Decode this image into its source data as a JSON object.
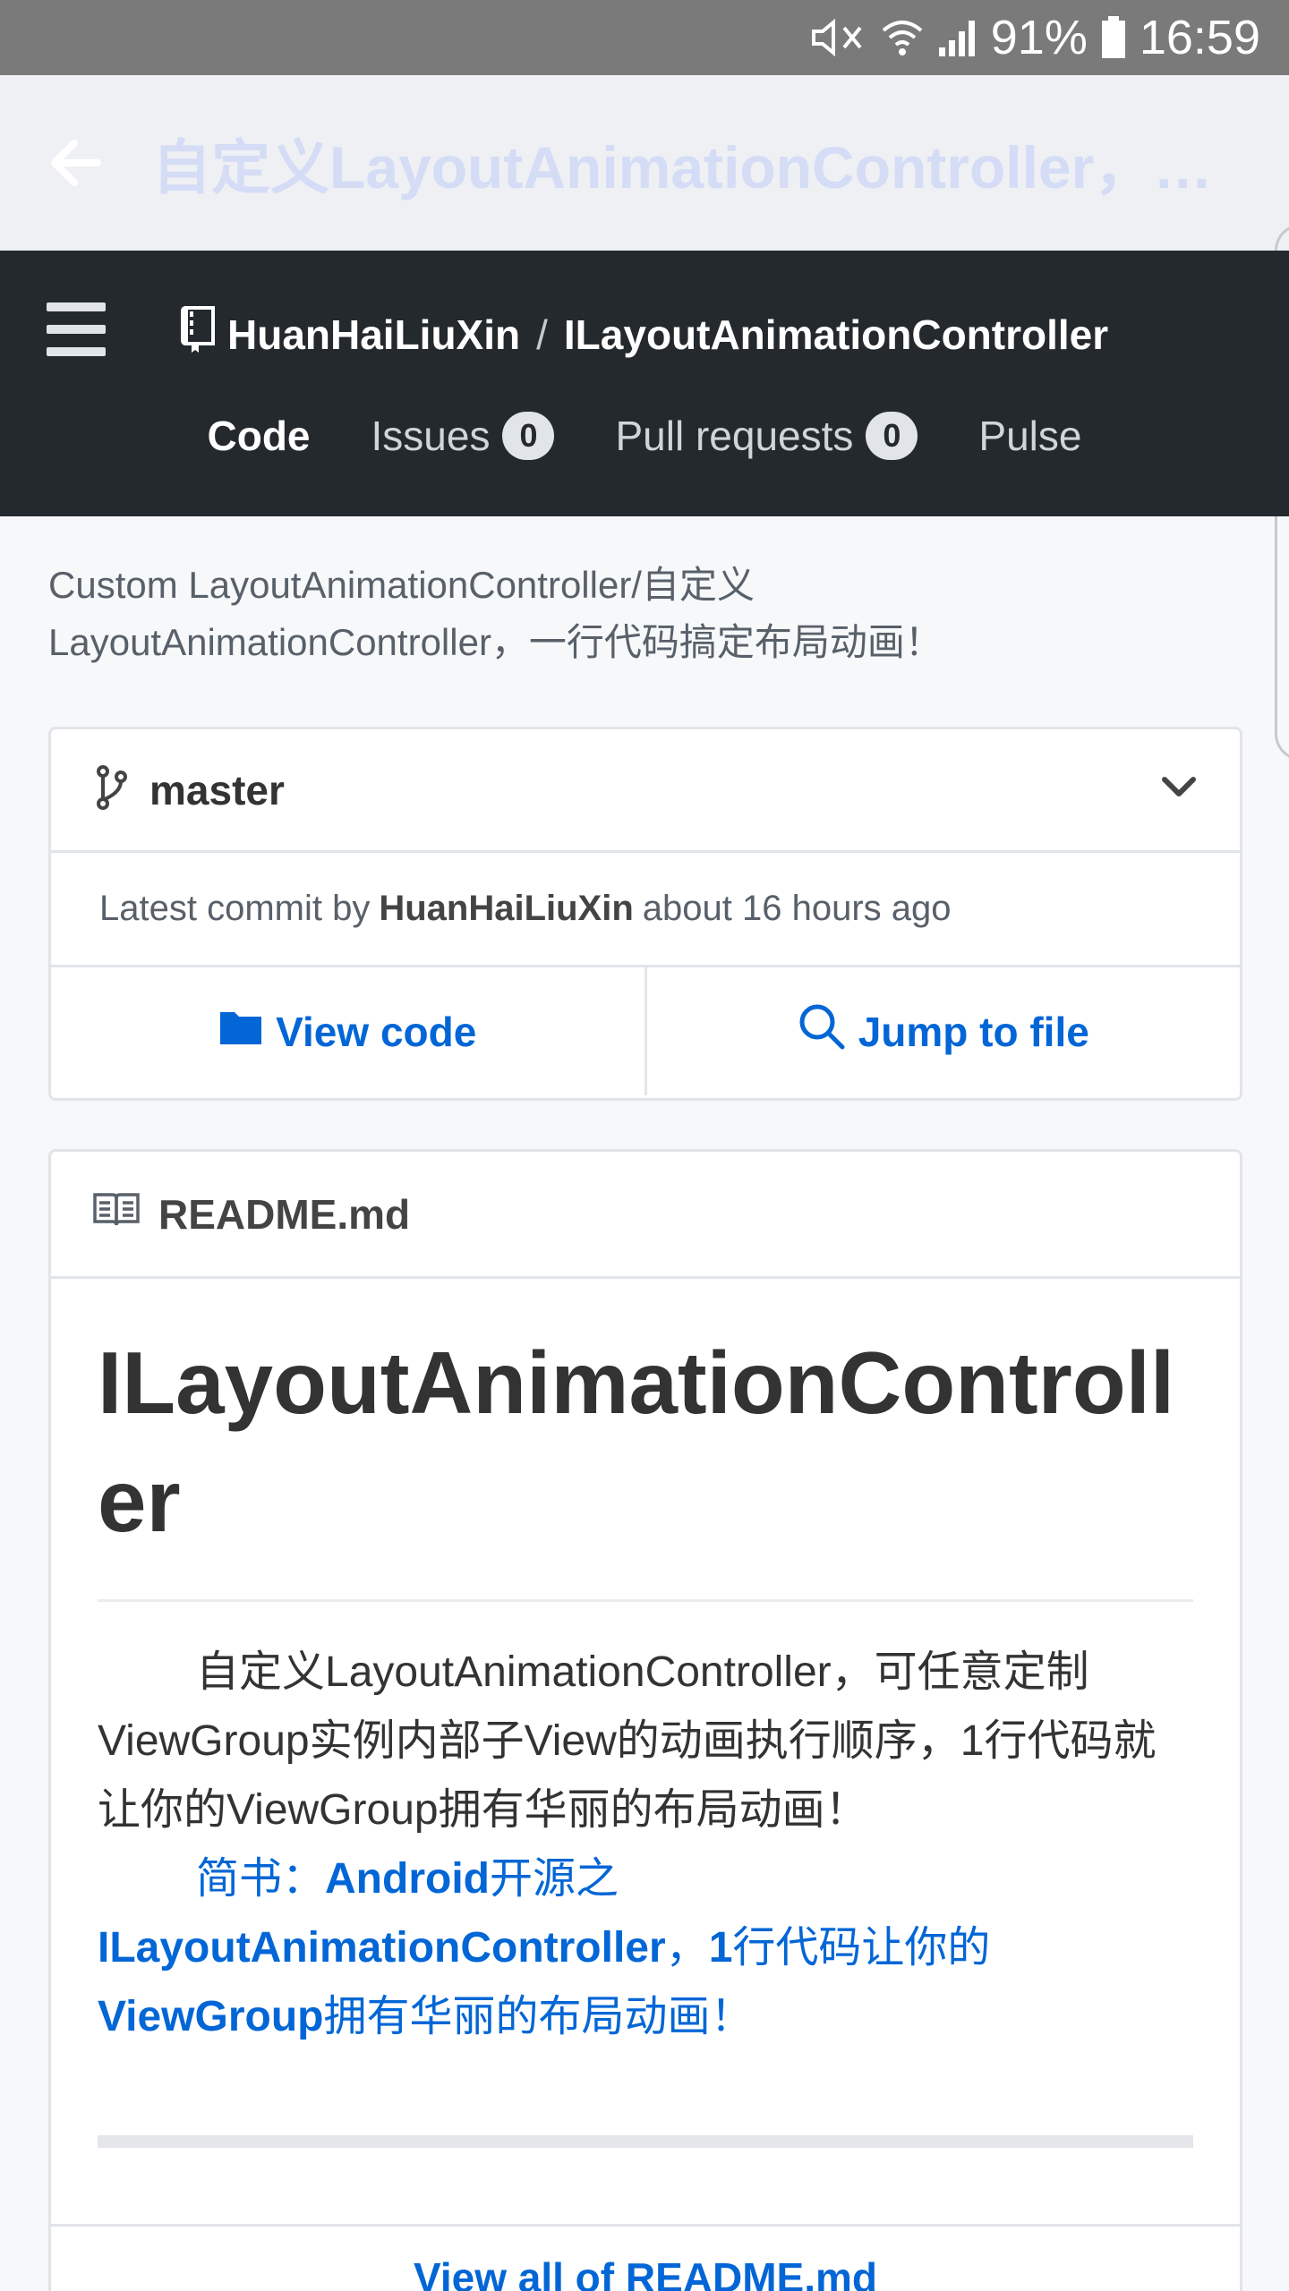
{
  "status_bar": {
    "battery": "91%",
    "time": "16:59"
  },
  "app_bar": {
    "title": "自定义LayoutAnimationController，一..."
  },
  "repo": {
    "owner": "HuanHaiLiuXin",
    "separator": "/",
    "name": "ILayoutAnimationController",
    "tabs": [
      {
        "label": "Code",
        "active": true
      },
      {
        "label": "Issues",
        "count": "0"
      },
      {
        "label": "Pull requests",
        "count": "0"
      },
      {
        "label": "Pulse"
      }
    ]
  },
  "description": "Custom LayoutAnimationController/自定义LayoutAnimationController，一行代码搞定布局动画！",
  "branch": {
    "name": "master",
    "commit_prefix": "Latest commit by",
    "commit_author": "HuanHaiLiuXin",
    "commit_time": "about 16 hours ago",
    "view_code_label": "View code",
    "jump_to_file_label": "Jump to file"
  },
  "readme": {
    "filename": "README.md",
    "heading": "ILayoutAnimationController",
    "paragraph": "自定义LayoutAnimationController，可任意定制ViewGroup实例内部子View的动画执行顺序，1行代码就让你的ViewGroup拥有华丽的布局动画！",
    "link_parts": [
      {
        "text": "简书：",
        "bold": false
      },
      {
        "text": "Android",
        "bold": true
      },
      {
        "text": "开源之",
        "bold": false
      },
      {
        "text": "ILayoutAnimationController",
        "bold": true
      },
      {
        "text": "，",
        "bold": false
      },
      {
        "text": "1",
        "bold": true
      },
      {
        "text": "行代码让你的",
        "bold": false
      },
      {
        "text": "ViewGroup",
        "bold": true
      },
      {
        "text": "拥有华丽的布局动画！",
        "bold": false
      }
    ],
    "view_all_label": "View all of README.md"
  },
  "colors": {
    "header_bg": "#24292e",
    "link": "#0366d6",
    "status_bar_bg": "#7a7a7a",
    "app_bar_bg": "#eef0f3"
  }
}
